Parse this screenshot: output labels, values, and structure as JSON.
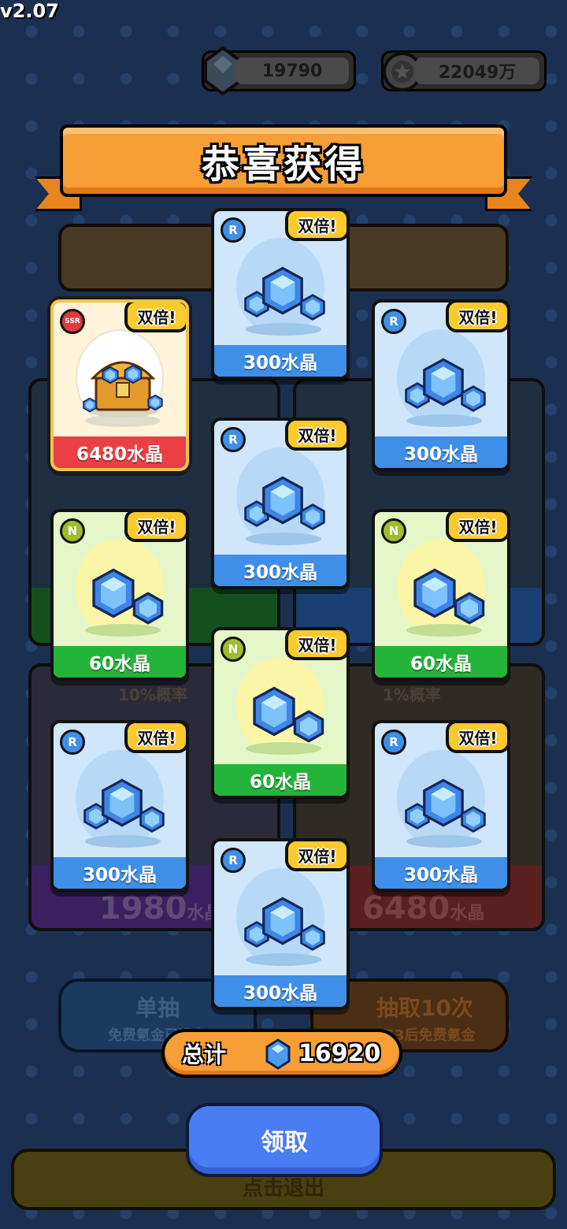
{
  "version": "v2.07",
  "currency": {
    "crystal": "19790",
    "coin": "22049万"
  },
  "banner": {
    "title": "恭喜获得"
  },
  "background": {
    "left_rate": "10%概率",
    "right_rate": "1%概率",
    "left_price": "1980",
    "left_unit": "水晶",
    "right_price": "6480",
    "right_unit": "水晶",
    "single_draw": "单抽",
    "single_sub": "免费氪金已准备",
    "ten_draw": "抽取10次",
    "ten_sub": "7:48:53后免费氪金",
    "exit": "点击退出"
  },
  "cards": [
    {
      "rarity": "SSR",
      "double": "双倍!",
      "label": "6480水晶",
      "icon": "treasure-chest-icon"
    },
    {
      "rarity": "R",
      "double": "双倍!",
      "label": "300水晶",
      "icon": "crystal-cluster-icon"
    },
    {
      "rarity": "R",
      "double": "双倍!",
      "label": "300水晶",
      "icon": "crystal-cluster-icon"
    },
    {
      "rarity": "R",
      "double": "双倍!",
      "label": "300水晶",
      "icon": "crystal-cluster-icon"
    },
    {
      "rarity": "N",
      "double": "双倍!",
      "label": "60水晶",
      "icon": "crystal-pair-icon"
    },
    {
      "rarity": "N",
      "double": "双倍!",
      "label": "60水晶",
      "icon": "crystal-pair-icon"
    },
    {
      "rarity": "N",
      "double": "双倍!",
      "label": "60水晶",
      "icon": "crystal-pair-icon"
    },
    {
      "rarity": "R",
      "double": "双倍!",
      "label": "300水晶",
      "icon": "crystal-cluster-icon"
    },
    {
      "rarity": "R",
      "double": "双倍!",
      "label": "300水晶",
      "icon": "crystal-cluster-icon"
    },
    {
      "rarity": "R",
      "double": "双倍!",
      "label": "300水晶",
      "icon": "crystal-cluster-icon"
    }
  ],
  "total": {
    "label": "总计",
    "value": "16920"
  },
  "claim_button": "领取",
  "colors": {
    "orange": "#f79e36",
    "blue_card": "#3f8ee8",
    "green_card": "#25b43a",
    "red_card": "#ea3f43",
    "gold": "#fbca2c",
    "claim": "#4a7cf4"
  }
}
